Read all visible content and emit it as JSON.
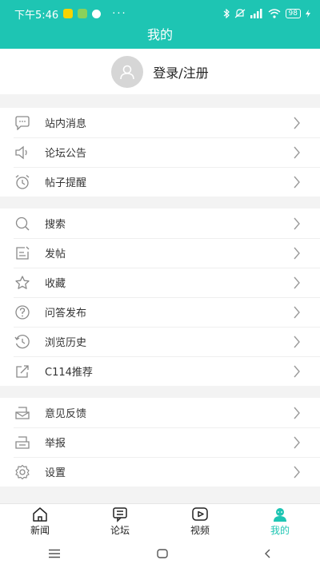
{
  "status_bar": {
    "time": "下午5:46",
    "overflow": "···",
    "battery": "98"
  },
  "header": {
    "title": "我的"
  },
  "profile": {
    "login_label": "登录/注册"
  },
  "groups": [
    {
      "items": [
        {
          "label": "站内消息",
          "icon": "message-icon"
        },
        {
          "label": "论坛公告",
          "icon": "speaker-icon"
        },
        {
          "label": "帖子提醒",
          "icon": "alarm-clock-icon"
        }
      ]
    },
    {
      "items": [
        {
          "label": "搜索",
          "icon": "search-icon"
        },
        {
          "label": "发帖",
          "icon": "compose-icon"
        },
        {
          "label": "收藏",
          "icon": "star-icon"
        },
        {
          "label": "问答发布",
          "icon": "question-icon"
        },
        {
          "label": "浏览历史",
          "icon": "history-icon"
        },
        {
          "label": "C114推荐",
          "icon": "share-icon"
        }
      ]
    },
    {
      "items": [
        {
          "label": "意见反馈",
          "icon": "feedback-icon"
        },
        {
          "label": "举报",
          "icon": "report-icon"
        },
        {
          "label": "设置",
          "icon": "gear-icon"
        }
      ]
    }
  ],
  "tabbar": {
    "tabs": [
      {
        "label": "新闻",
        "icon": "home-icon",
        "active": false
      },
      {
        "label": "论坛",
        "icon": "forum-icon",
        "active": false
      },
      {
        "label": "视频",
        "icon": "video-icon",
        "active": false
      },
      {
        "label": "我的",
        "icon": "user-icon",
        "active": true
      }
    ]
  },
  "colors": {
    "accent": "#1ec5b3",
    "icon_gray": "#8a8a8a"
  }
}
